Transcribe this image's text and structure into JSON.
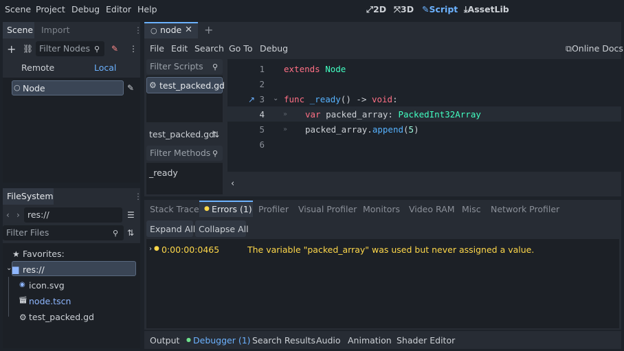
{
  "menu": [
    "Scene",
    "Project",
    "Debug",
    "Editor",
    "Help"
  ],
  "workspaces": [
    {
      "label": "2D",
      "icon": "2d-icon"
    },
    {
      "label": "3D",
      "icon": "3d-icon"
    },
    {
      "label": "Script",
      "icon": "script-icon"
    },
    {
      "label": "AssetLib",
      "icon": "assetlib-icon"
    }
  ],
  "scene_dock": {
    "tabs": [
      "Scene",
      "Import"
    ],
    "filter_placeholder": "Filter Nodes",
    "remote_label": "Remote",
    "local_label": "Local",
    "root_node": "Node"
  },
  "filesystem": {
    "tab": "FileSystem",
    "path": "res://",
    "filter_placeholder": "Filter Files",
    "favorites": "Favorites:",
    "root": "res://",
    "files": [
      "icon.svg",
      "node.tscn",
      "test_packed.gd"
    ]
  },
  "editor": {
    "scene_tab": "node",
    "script_menu": [
      "File",
      "Edit",
      "Search",
      "Go To",
      "Debug"
    ],
    "online_docs": "Online Docs",
    "filter_scripts": "Filter Scripts",
    "script_item": "test_packed.gd",
    "script_name": "test_packed.gd",
    "filter_methods": "Filter Methods",
    "method_item": "_ready",
    "line_numbers": [
      "1",
      "2",
      "3",
      "4",
      "5",
      "6"
    ],
    "code": {
      "l1_kw": "extends",
      "l1_type": "Node",
      "l3_kw": "func",
      "l3_name": "_ready",
      "l3_rest": "() -> ",
      "l3_type": "void",
      "l3_colon": ":",
      "l4_kw": "var",
      "l4_name": "packed_array: ",
      "l4_type": "PackedInt32Array",
      "l5_name": "packed_array.",
      "l5_fn": "append",
      "l5_open": "(",
      "l5_num": "5",
      "l5_close": ")"
    }
  },
  "debugger": {
    "tabs": [
      "Stack Trace",
      "Errors (1)",
      "Profiler",
      "Visual Profiler",
      "Monitors",
      "Video RAM",
      "Misc",
      "Network Profiler"
    ],
    "expand_all": "Expand All",
    "collapse_all": "Collapse All",
    "error_time": "0:00:00:0465",
    "error_message": "The variable \"packed_array\" was used but never assigned a value."
  },
  "bottom_tabs": [
    "Output",
    "Debugger (1)",
    "Search Results",
    "Audio",
    "Animation",
    "Shader Editor"
  ],
  "colors": {
    "accent": "#6cb2ff",
    "warning": "#ffd84a",
    "keyword": "#ff7085",
    "type": "#42ffc2"
  }
}
